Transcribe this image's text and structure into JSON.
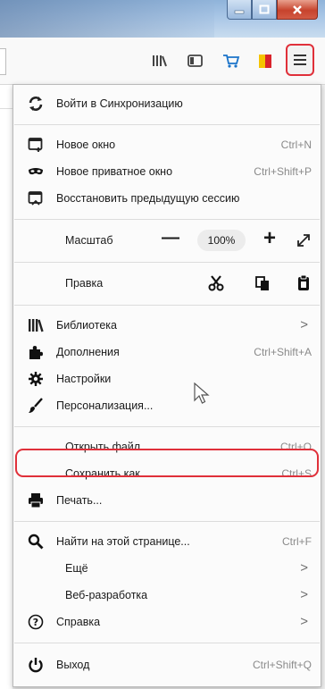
{
  "colors": {
    "accent_red": "#e0303a",
    "menu_bg": "#fbfbfb",
    "shortcut_gray": "#8a8a8a"
  },
  "window": {
    "buttons": [
      "minimize",
      "maximize",
      "close"
    ]
  },
  "toolbar": {
    "icons": [
      "library-icon",
      "sidebar-icon",
      "cart-icon",
      "flag-icon",
      "hamburger-menu-icon"
    ]
  },
  "menu": {
    "sync": {
      "label": "Войти в Синхронизацию",
      "icon": "sync-icon"
    },
    "new_window": {
      "label": "Новое окно",
      "shortcut": "Ctrl+N",
      "icon": "new-window-icon"
    },
    "private_window": {
      "label": "Новое приватное окно",
      "shortcut": "Ctrl+Shift+P",
      "icon": "mask-icon"
    },
    "restore_session": {
      "label": "Восстановить предыдущую сессию",
      "icon": "restore-icon"
    },
    "zoom": {
      "label": "Масштаб",
      "minus": "—",
      "value": "100%",
      "plus": "+",
      "fullscreen_icon": "fullscreen-icon"
    },
    "edit": {
      "label": "Правка",
      "icons": [
        "cut-icon",
        "copy-icon",
        "paste-icon"
      ]
    },
    "library": {
      "label": "Библиотека",
      "arrow": ">",
      "icon": "library-icon"
    },
    "addons": {
      "label": "Дополнения",
      "shortcut": "Ctrl+Shift+A",
      "icon": "puzzle-icon"
    },
    "settings": {
      "label": "Настройки",
      "icon": "gear-icon"
    },
    "customize": {
      "label": "Персонализация...",
      "icon": "brush-icon"
    },
    "open_file": {
      "label": "Открыть файл...",
      "shortcut": "Ctrl+O"
    },
    "save_as": {
      "label": "Сохранить как...",
      "shortcut": "Ctrl+S"
    },
    "print": {
      "label": "Печать...",
      "icon": "printer-icon"
    },
    "find": {
      "label": "Найти на этой странице...",
      "shortcut": "Ctrl+F",
      "icon": "search-icon"
    },
    "more": {
      "label": "Ещё",
      "arrow": ">"
    },
    "web_dev": {
      "label": "Веб-разработка",
      "arrow": ">"
    },
    "help": {
      "label": "Справка",
      "arrow": ">",
      "icon": "help-icon"
    },
    "quit": {
      "label": "Выход",
      "shortcut": "Ctrl+Shift+Q",
      "icon": "power-icon"
    }
  }
}
